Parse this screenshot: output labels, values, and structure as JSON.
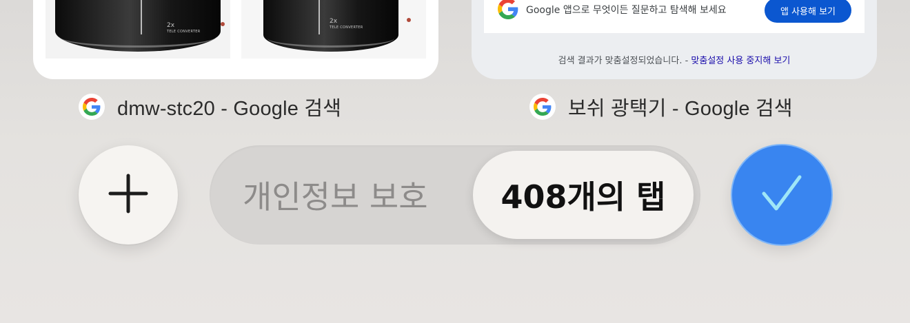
{
  "tab_cards": [
    {
      "title": "dmw-stc20 - Google 검색",
      "icon": "google-icon",
      "preview": {
        "lens_label_main": "2x",
        "lens_label_sub": "TELE CONVERTER"
      }
    },
    {
      "title": "보쉬 광택기 - Google 검색",
      "icon": "google-icon",
      "preview": {
        "promo_text": "Google 앱으로 무엇이든 질문하고 탐색해 보세요",
        "promo_button": "앱 사용해 보기",
        "personal_note": "검색 결과가 맞춤설정되었습니다. - ",
        "personal_link": "맞춤설정 사용 중지해 보기"
      }
    }
  ],
  "toolbar": {
    "add_icon": "plus-icon",
    "private_label": "개인정보 보호",
    "tabs_label": "408개의 탭",
    "done_icon": "checkmark-icon"
  },
  "colors": {
    "accent_blue": "#3985f0",
    "google_button": "#0b57d0",
    "link": "#1a0dab"
  }
}
